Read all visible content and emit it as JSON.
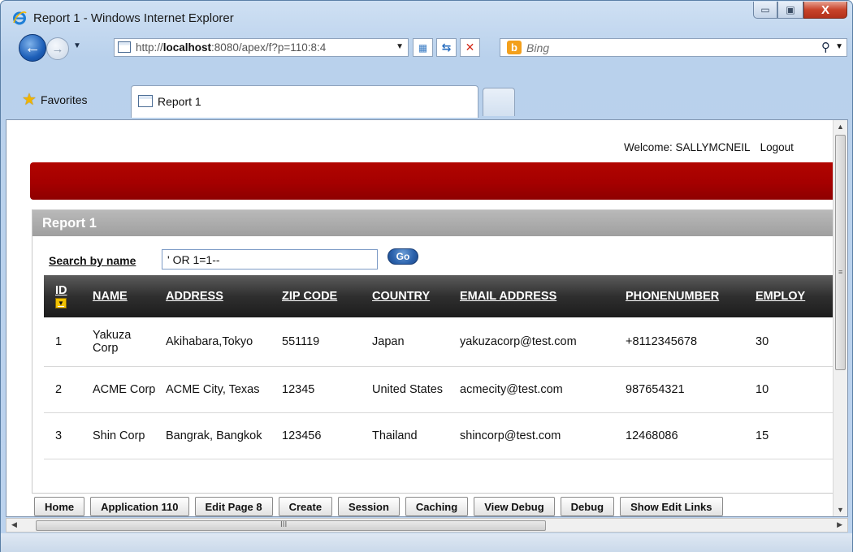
{
  "window": {
    "title": "Report 1 - Windows Internet Explorer",
    "minimize_glyph": "▭",
    "maximize_glyph": "▣",
    "close_glyph": "X"
  },
  "nav": {
    "back_icon": "arrow-left-icon",
    "forward_icon": "arrow-right-icon",
    "url_prefix": "http://",
    "url_host": "localhost",
    "url_rest": ":8080/apex/f?p=110:8:4",
    "compat_icon": "compat-view-icon",
    "refresh_icon": "refresh-icon",
    "stop_icon": "stop-icon",
    "search_provider": "b",
    "search_placeholder": "Bing"
  },
  "tabs": {
    "favorites_label": "Favorites",
    "active_tab_label": "Report 1"
  },
  "header": {
    "welcome_text": "Welcome: SALLYMCNEIL",
    "logout_label": "Logout",
    "brand_color": "#b10500"
  },
  "region": {
    "title": "Report 1"
  },
  "search": {
    "label": "Search by name",
    "value": "' OR 1=1--",
    "go_label": "Go"
  },
  "table": {
    "columns": [
      "ID",
      "NAME",
      "ADDRESS",
      "ZIP_CODE",
      "COUNTRY",
      "EMAIL_ADDRESS",
      "PHONENUMBER",
      "EMPLOYEES"
    ],
    "columns_display": [
      "ID",
      "NAME",
      "ADDRESS",
      "ZIP CODE",
      "COUNTRY",
      "EMAIL ADDRESS",
      "PHONENUMBER",
      "EMPLOY"
    ],
    "rows": [
      [
        "1",
        "Yakuza Corp",
        "Akihabara,Tokyo",
        "551119",
        "Japan",
        "yakuzacorp@test.com",
        "+8112345678",
        "30"
      ],
      [
        "2",
        "ACME Corp",
        "ACME City, Texas",
        "12345",
        "United States",
        "acmecity@test.com",
        "987654321",
        "10"
      ],
      [
        "3",
        "Shin Corp",
        "Bangrak, Bangkok",
        "123456",
        "Thailand",
        "shincorp@test.com",
        "12468086",
        "15"
      ]
    ]
  },
  "devbar": {
    "buttons": [
      "Home",
      "Application 110",
      "Edit Page 8",
      "Create",
      "Session",
      "Caching",
      "View Debug",
      "Debug",
      "Show Edit Links"
    ]
  },
  "scrollbar": {
    "grip": "III"
  }
}
